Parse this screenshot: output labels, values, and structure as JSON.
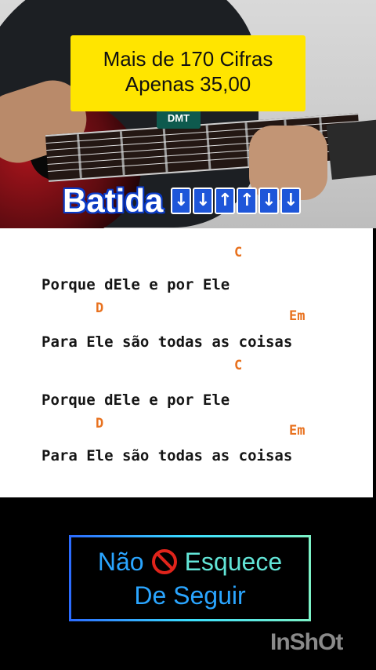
{
  "promo": {
    "line1": "Mais de 170 Cifras",
    "line2": "Apenas 35,00"
  },
  "shirt_logo": "DMT",
  "strum": {
    "label": "Batida",
    "arrows": [
      "↓",
      "↓",
      "↑",
      "↑",
      "↓",
      "↓"
    ]
  },
  "sheet": {
    "c1": "C",
    "lyric1": "Porque dEle e por Ele",
    "d1": "D",
    "em1": "Em",
    "lyric2": "Para Ele são todas as coisas",
    "c2": "C",
    "lyric3": "Porque dEle e por Ele",
    "d2": "D",
    "em2": "Em",
    "lyric4": "Para Ele são todas as coisas"
  },
  "cta": {
    "word1": "Não",
    "word2": "Esquece",
    "line2": "De Seguir",
    "icon": "prohibited-icon"
  },
  "watermark": "InShOt",
  "colors": {
    "promo_bg": "#ffe500",
    "chord": "#e8711e",
    "arrow_bg": "#1e56d9"
  }
}
